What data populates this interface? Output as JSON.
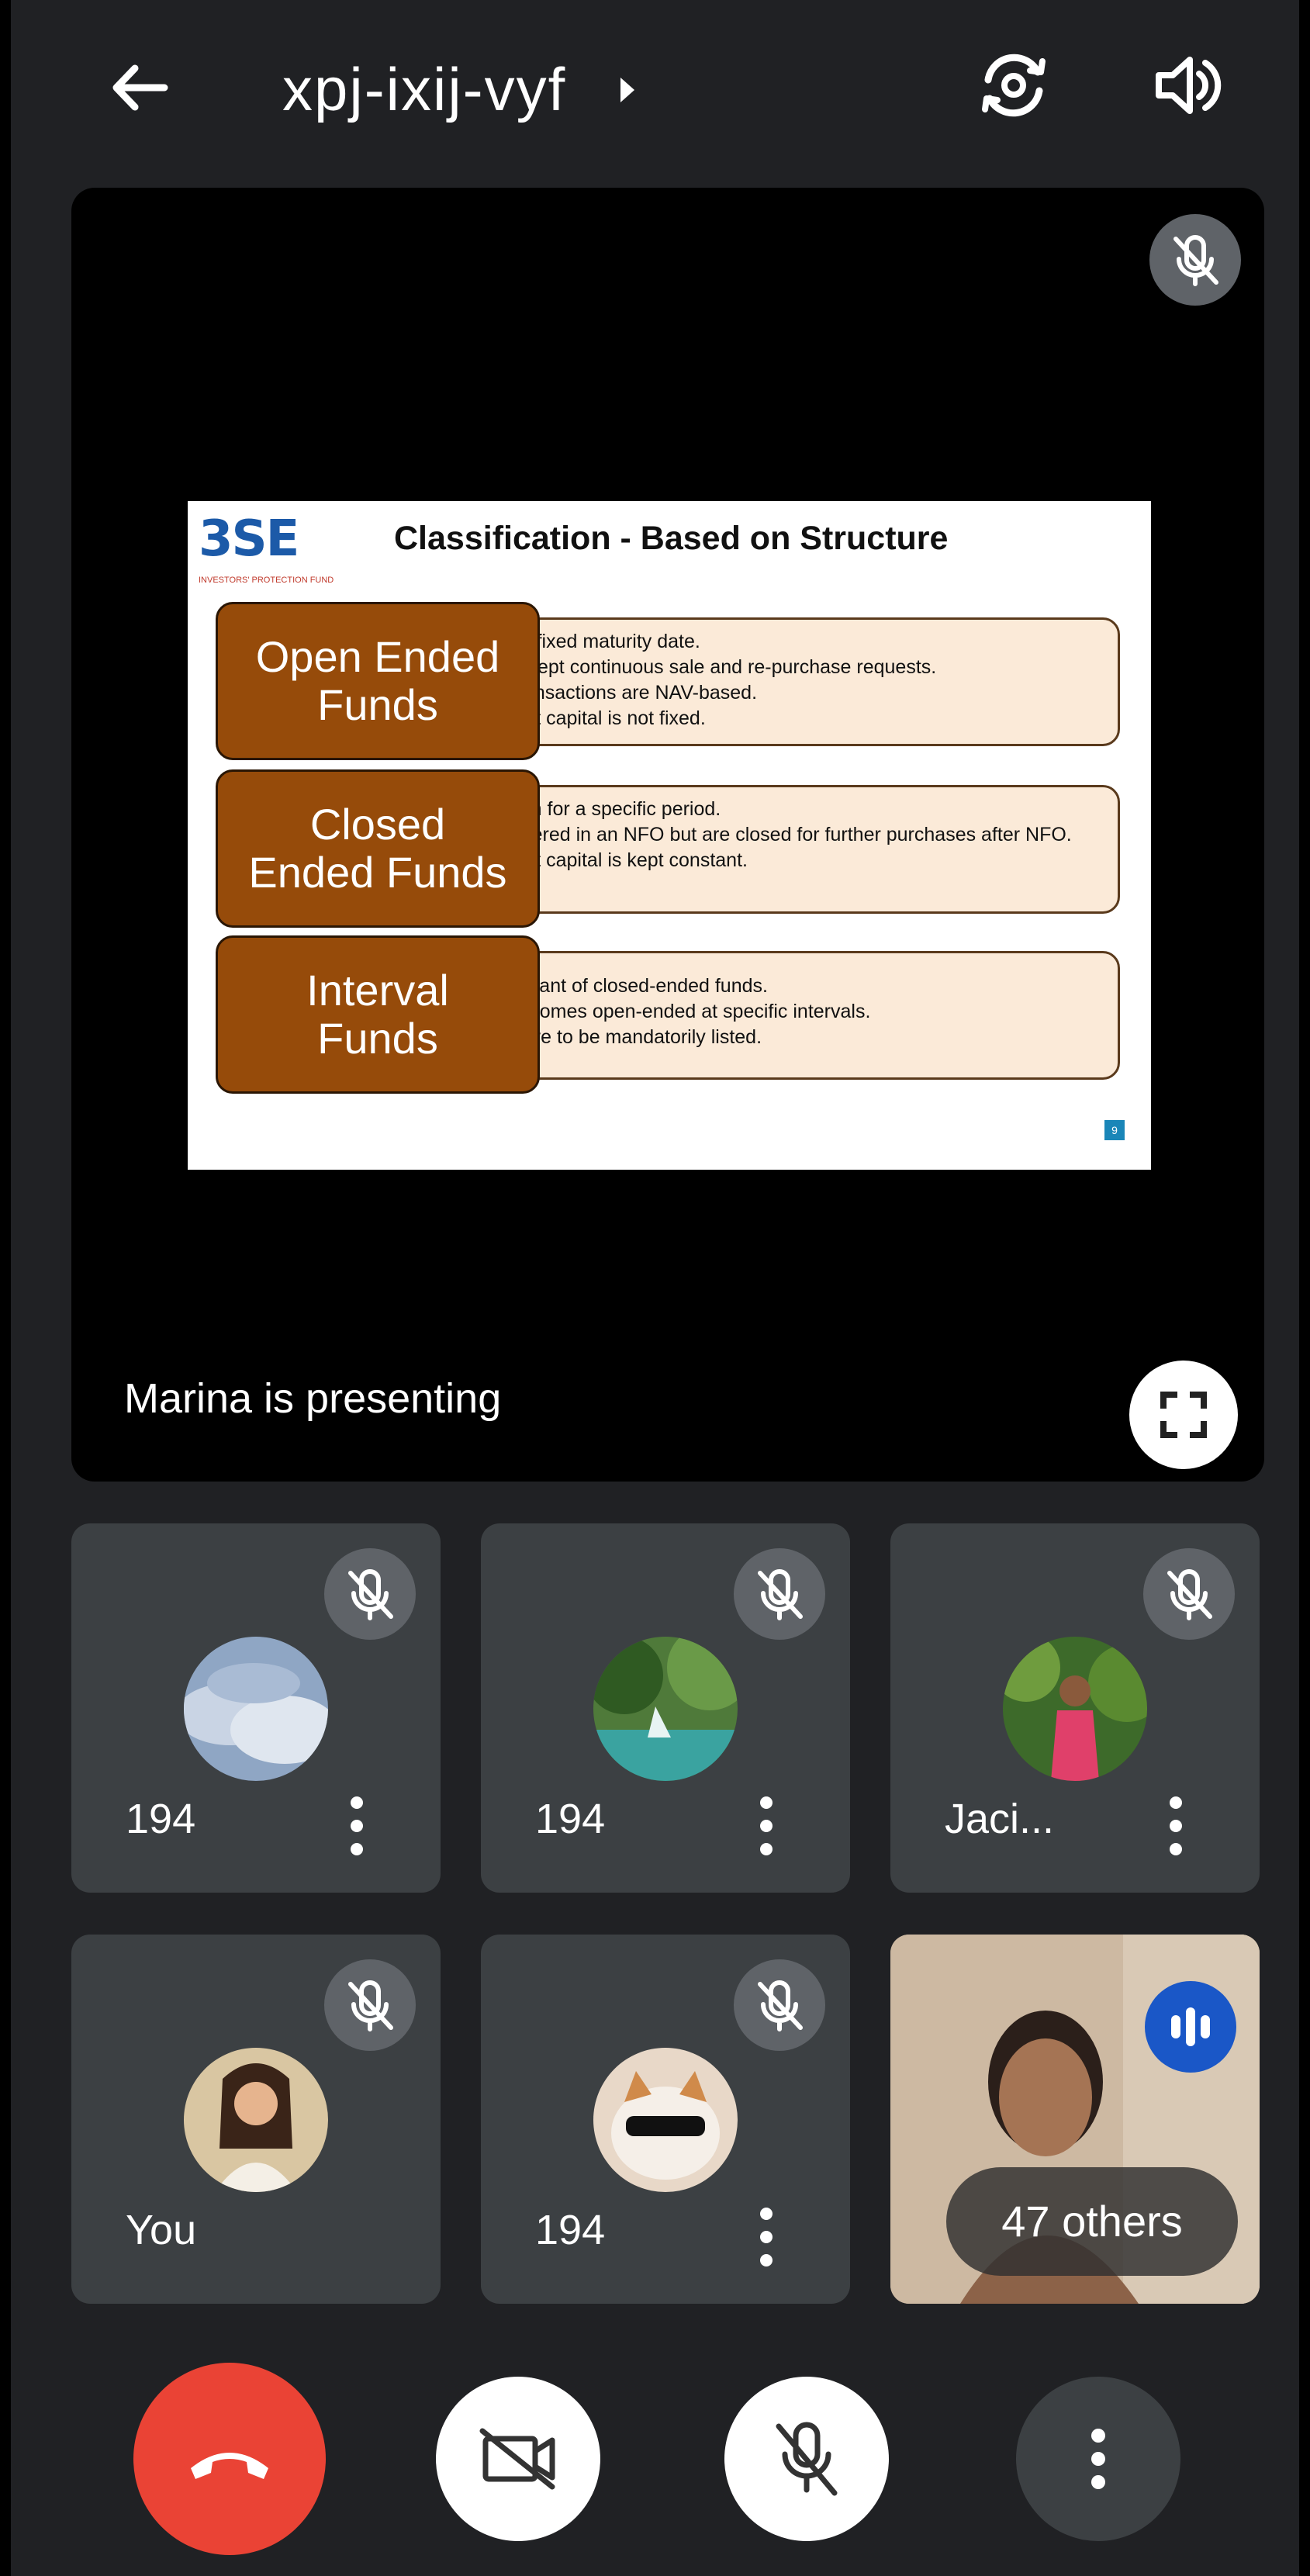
{
  "topbar": {
    "meeting_code": "xpj-ixij-vyf"
  },
  "presentation": {
    "presenter_text": "Marina is presenting",
    "slide": {
      "logo_text": "3SE",
      "logo_subtext": "INVESTORS' PROTECTION FUND",
      "title": "Classification - Based on Structure",
      "page_number": "9",
      "rows": [
        {
          "label_line1": "Open Ended",
          "label_line2": "Funds",
          "bullets": [
            "No fixed maturity date.",
            "Accept continuous sale and re-purchase requests.",
            "Transactions are NAV-based.",
            "Unit capital is not fixed."
          ]
        },
        {
          "label_line1": "Closed",
          "label_line2": "Ended Funds",
          "bullets": [
            "Run for a specific period.",
            "Offered in an NFO but are closed for further purchases after NFO.",
            "Unit capital is kept constant."
          ]
        },
        {
          "label_line1": "Interval",
          "label_line2": "Funds",
          "bullets": [
            "Variant of closed-ended funds.",
            "Becomes open-ended at specific intervals.",
            "Have to be mandatorily listed."
          ]
        }
      ]
    }
  },
  "participants": [
    {
      "name": "194",
      "avatar": "clouds-avatar"
    },
    {
      "name": "194",
      "avatar": "forest-avatar"
    },
    {
      "name": "Jaci...",
      "avatar": "person-avatar"
    },
    {
      "name": "You",
      "avatar": "self-avatar"
    },
    {
      "name": "194",
      "avatar": "cat-avatar"
    }
  ],
  "others_tile": {
    "label": "47 others"
  },
  "colors": {
    "end_call": "#ea4335",
    "tile_bg": "#3c4043",
    "app_bg": "#202124",
    "speaking_badge": "#1a57c7"
  }
}
